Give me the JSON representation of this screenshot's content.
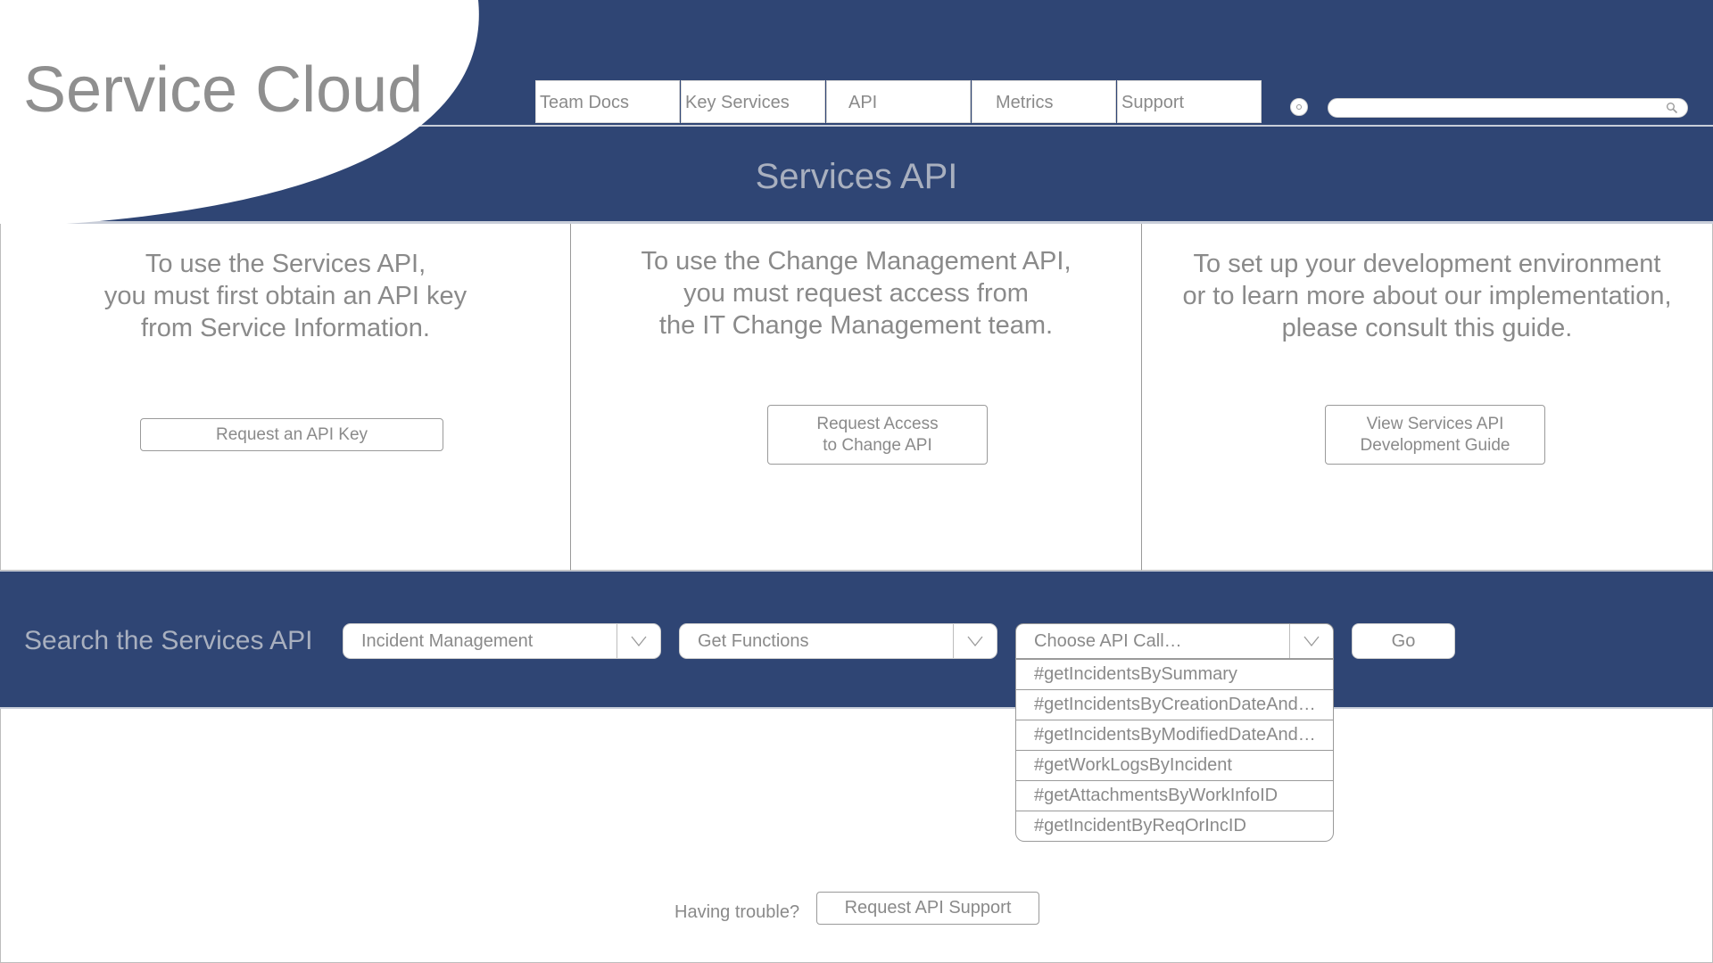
{
  "brand": {
    "name": "Service Cloud"
  },
  "nav": {
    "tabs": [
      {
        "label": "Team Docs"
      },
      {
        "label": "Key Services"
      },
      {
        "label": "API"
      },
      {
        "label": "Metrics"
      },
      {
        "label": "Support"
      }
    ],
    "search_value": ""
  },
  "page": {
    "title": "Services API"
  },
  "panels": [
    {
      "lines": [
        "To use the Services API,",
        "you must first obtain an API key",
        "from Service Information."
      ],
      "button": "Request an API Key"
    },
    {
      "lines": [
        "To use the Change Management API,",
        "you must request access from",
        "the IT Change Management team."
      ],
      "button_lines": [
        "Request Access",
        "to Change API"
      ]
    },
    {
      "lines": [
        "To set up your development environment",
        "or to learn more about our implementation,",
        "please consult this guide."
      ],
      "button_lines": [
        "View Services API",
        "Development Guide"
      ]
    }
  ],
  "search": {
    "label": "Search the Services API",
    "category": "Incident Management",
    "function_type": "Get Functions",
    "api_call_placeholder": "Choose API Call…",
    "go_label": "Go",
    "api_calls": [
      "#getIncidentsBySummary",
      "#getIncidentsByCreationDateAnd…",
      "#getIncidentsByModifiedDateAnd…",
      "#getWorkLogsByIncident",
      "#getAttachmentsByWorkInfoID",
      "#getIncidentByReqOrIncID"
    ]
  },
  "footer": {
    "trouble_text": "Having trouble?",
    "support_button": "Request API Support"
  },
  "colors": {
    "navy": "#2f4574",
    "header_text": "#a9b0bf",
    "body_text": "#8a8a8a"
  },
  "icons": {
    "search": "magnifier-icon",
    "settings": "settings-dot-icon",
    "dropdown": "chevron-down-icon"
  }
}
